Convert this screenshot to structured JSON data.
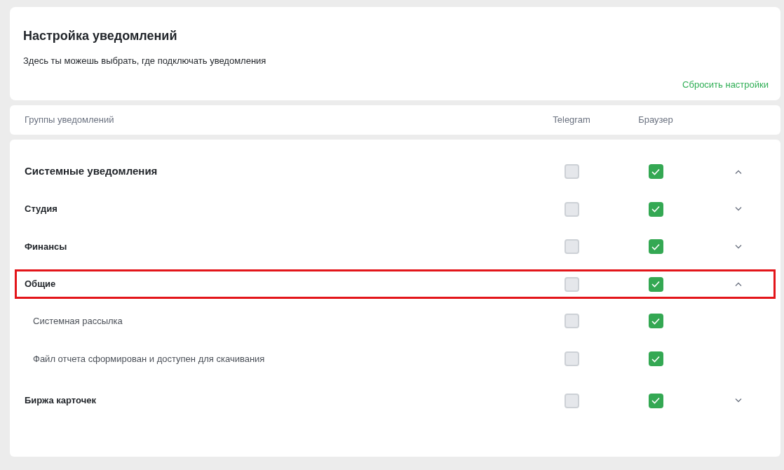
{
  "header": {
    "title": "Настройка уведомлений",
    "subtitle": "Здесь ты можешь выбрать, где подключать уведомления",
    "reset_link": "Сбросить настройки"
  },
  "columns": {
    "groups": "Группы уведомлений",
    "telegram": "Telegram",
    "browser": "Браузер"
  },
  "groups": [
    {
      "kind": "title",
      "label": "Системные уведомления",
      "telegram": false,
      "browser": true,
      "expanded": true,
      "highlighted": false
    },
    {
      "kind": "group",
      "label": "Студия",
      "telegram": false,
      "browser": true,
      "expanded": false,
      "highlighted": false
    },
    {
      "kind": "group",
      "label": "Финансы",
      "telegram": false,
      "browser": true,
      "expanded": false,
      "highlighted": false
    },
    {
      "kind": "group",
      "label": "Общие",
      "telegram": false,
      "browser": true,
      "expanded": true,
      "highlighted": true,
      "children": [
        {
          "label": "Системная рассылка",
          "telegram": false,
          "browser": true
        },
        {
          "label": "Файл отчета сформирован и доступен для скачивания",
          "telegram": false,
          "browser": true
        }
      ]
    },
    {
      "kind": "group",
      "label": "Биржа карточек",
      "telegram": false,
      "browser": true,
      "expanded": false,
      "highlighted": false
    }
  ]
}
